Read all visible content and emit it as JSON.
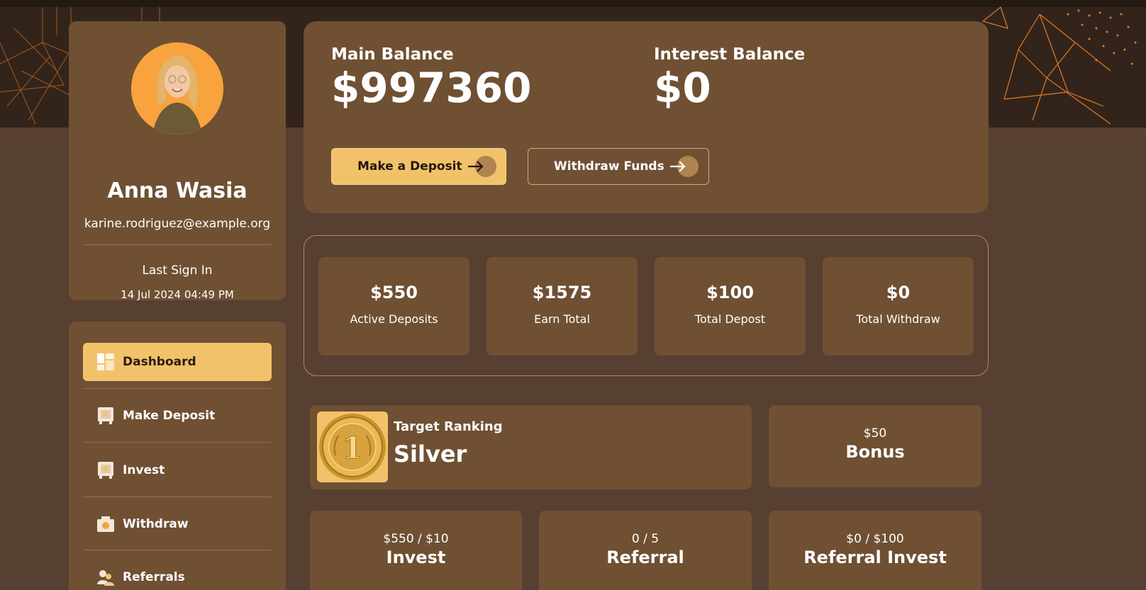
{
  "profile": {
    "name": "Anna Wasia",
    "email": "karine.rodriguez@example.org",
    "last_sign_in_label": "Last Sign In",
    "last_sign_in_date": "14 Jul 2024 04:49 PM"
  },
  "menu": {
    "items": [
      {
        "label": "Dashboard",
        "icon": "dashboard-icon",
        "active": true
      },
      {
        "label": "Make Deposit",
        "icon": "safe-icon"
      },
      {
        "label": "Invest",
        "icon": "safe-icon"
      },
      {
        "label": "Withdraw",
        "icon": "cash-register-icon"
      },
      {
        "label": "Referrals",
        "icon": "users-icon"
      }
    ]
  },
  "balances": {
    "main_label": "Main Balance",
    "main_value": "$997360",
    "interest_label": "Interest Balance",
    "interest_value": "$0",
    "deposit_button": "Make a Deposit",
    "withdraw_button": "Withdraw Funds"
  },
  "stats": [
    {
      "value": "$550",
      "label": "Active Deposits"
    },
    {
      "value": "$1575",
      "label": "Earn Total"
    },
    {
      "value": "$100",
      "label": "Total Depost"
    },
    {
      "value": "$0",
      "label": "Total Withdraw"
    }
  ],
  "ranking": {
    "label": "Target Ranking",
    "value": "Silver",
    "badge_number": "1"
  },
  "bonus": {
    "amount": "$50",
    "label": "Bonus"
  },
  "requirements": [
    {
      "top": "$550 / $10",
      "label": "Invest"
    },
    {
      "top": "0 / 5",
      "label": "Referral"
    },
    {
      "top": "$0 / $100",
      "label": "Referral Invest"
    }
  ],
  "colors": {
    "background": "#573f31",
    "card": "#6f5033",
    "accent": "#f2c26b",
    "hero": "#32241a",
    "hero_lines": "#e07a2a"
  }
}
